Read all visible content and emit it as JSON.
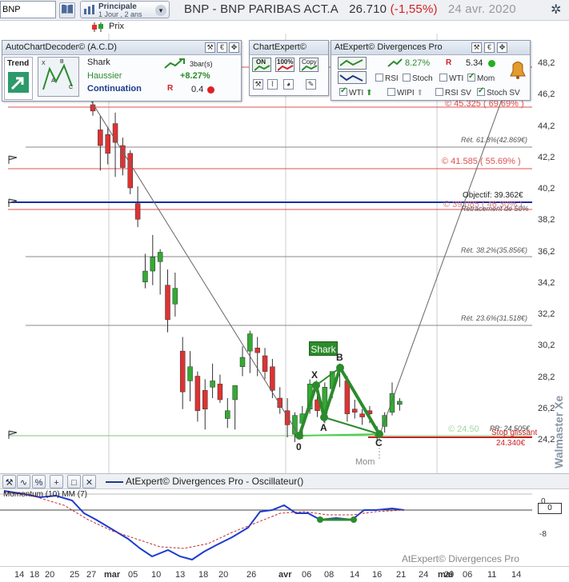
{
  "toolbar": {
    "symbol": "BNP",
    "period_main": "Principale",
    "period_sub": "1 Jour , 2 ans",
    "price_type": "Prix"
  },
  "title": {
    "name": "BNP - BNP PARIBAS ACT.A",
    "price": "26.710",
    "change": "(-1,55%)",
    "date": "24 avr. 2020"
  },
  "acd_panel": {
    "title": "AutoChartDecoder© (A.C.D)",
    "trend_label": "Trend",
    "pattern": "Shark",
    "direction": "Haussier",
    "signal": "Continuation",
    "bars_label": "3bar(s)",
    "gain": "+8.27%",
    "risk": "0.4",
    "mini_letters": [
      "X",
      "B",
      "A",
      "C"
    ]
  },
  "chartexpert_panel": {
    "title": "ChartExpert©",
    "on_label": "ON",
    "pct_label": "100%",
    "copy_label": "Copy"
  },
  "atexpert_panel": {
    "title": "AtExpert© Divergences Pro",
    "gain": "8.27%",
    "value": "5.34",
    "options": [
      {
        "label": "RSI",
        "checked": false
      },
      {
        "label": "Stoch",
        "checked": false
      },
      {
        "label": "WTI",
        "checked": false
      },
      {
        "label": "Mom",
        "checked": true
      }
    ],
    "options2": [
      {
        "label": "WTI",
        "checked": true
      },
      {
        "label": "WIPI",
        "checked": false
      },
      {
        "label": "RSI SV",
        "checked": false
      },
      {
        "label": "Stoch SV",
        "checked": true
      }
    ]
  },
  "chart": {
    "y_ticks": [
      "48,2",
      "46,2",
      "44,2",
      "42,2",
      "40,2",
      "38,2",
      "36,2",
      "34,2",
      "32,2",
      "30,2",
      "28,2",
      "26,2",
      "24,2"
    ],
    "levels": {
      "l1": "© 45.325 ( 69.69% )",
      "l2": "Rét. 61.8%(42.869€)",
      "l3": "© 41.585 ( 55.69% )",
      "l4": "Objectif: 39.362€",
      "l5": "© 39.085 ( 46.30% )",
      "l6": "Retracement de 50%",
      "l7": "Rét. 38.2%(35.856€)",
      "l8": "Rét. 23.6%(31.518€)",
      "l9": "© 24.50",
      "l10": "PR: 24.505€",
      "l11": "Stop glissant",
      "l12": "24.340€"
    },
    "pattern_label": "Shark",
    "points": [
      "X",
      "A",
      "B",
      "C",
      "0"
    ],
    "mom_label": "Mom",
    "watermark": "Walmaster Xe"
  },
  "oscillator": {
    "header": "AtExpert© Divergences Pro - Oscillateur()",
    "sub_label": "Momentum (10) MM (7)",
    "y_ticks": [
      "0",
      "-8"
    ],
    "current_value": "0",
    "footer": "AtExpert© Divergences Pro"
  },
  "xaxis": {
    "labels": [
      "14",
      "18",
      "20",
      "25",
      "27",
      "mar",
      "05",
      "10",
      "13",
      "18",
      "20",
      "26",
      "avr",
      "06",
      "08",
      "14",
      "16",
      "21",
      "24",
      "29",
      "mai",
      "06",
      "11",
      "14"
    ]
  },
  "chart_data": {
    "type": "candlestick",
    "candles": [
      {
        "o": 45.6,
        "h": 46.4,
        "l": 44.9,
        "c": 45.2
      },
      {
        "o": 44.0,
        "h": 44.9,
        "l": 41.4,
        "c": 43.0
      },
      {
        "o": 43.7,
        "h": 44.2,
        "l": 41.8,
        "c": 42.5
      },
      {
        "o": 44.4,
        "h": 45.1,
        "l": 41.0,
        "c": 43.2
      },
      {
        "o": 43.0,
        "h": 43.5,
        "l": 41.1,
        "c": 41.6
      },
      {
        "o": 42.5,
        "h": 42.7,
        "l": 39.9,
        "c": 40.3
      },
      {
        "o": 39.3,
        "h": 40.4,
        "l": 37.8,
        "c": 38.3
      },
      {
        "o": 34.3,
        "h": 36.1,
        "l": 33.9,
        "c": 35.0
      },
      {
        "o": 35.0,
        "h": 37.3,
        "l": 34.1,
        "c": 35.9
      },
      {
        "o": 35.6,
        "h": 36.4,
        "l": 33.5,
        "c": 36.2
      },
      {
        "o": 34.1,
        "h": 35.1,
        "l": 31.1,
        "c": 31.9
      },
      {
        "o": 32.9,
        "h": 34.9,
        "l": 32.1,
        "c": 33.9
      },
      {
        "o": 29.9,
        "h": 30.8,
        "l": 26.2,
        "c": 27.3
      },
      {
        "o": 28.0,
        "h": 29.9,
        "l": 26.7,
        "c": 28.9
      },
      {
        "o": 28.3,
        "h": 28.6,
        "l": 25.4,
        "c": 26.1
      },
      {
        "o": 27.4,
        "h": 28.1,
        "l": 24.9,
        "c": 26.2
      },
      {
        "o": 27.6,
        "h": 29.1,
        "l": 26.9,
        "c": 28.0
      },
      {
        "o": 27.8,
        "h": 28.4,
        "l": 26.6,
        "c": 26.8
      },
      {
        "o": 25.6,
        "h": 26.9,
        "l": 25.0,
        "c": 26.1
      },
      {
        "o": 26.8,
        "h": 27.6,
        "l": 24.9,
        "c": 27.7
      },
      {
        "o": 28.9,
        "h": 30.2,
        "l": 28.3,
        "c": 29.5
      },
      {
        "o": 29.9,
        "h": 31.2,
        "l": 28.5,
        "c": 31.0
      },
      {
        "o": 30.1,
        "h": 30.8,
        "l": 28.3,
        "c": 29.8
      },
      {
        "o": 29.6,
        "h": 30.1,
        "l": 28.1,
        "c": 28.6
      },
      {
        "o": 28.9,
        "h": 29.4,
        "l": 26.9,
        "c": 27.4
      },
      {
        "o": 26.9,
        "h": 27.6,
        "l": 25.9,
        "c": 26.3
      },
      {
        "o": 26.1,
        "h": 26.9,
        "l": 24.4,
        "c": 25.2
      },
      {
        "o": 24.6,
        "h": 26.0,
        "l": 24.1,
        "c": 25.8
      },
      {
        "o": 25.3,
        "h": 26.4,
        "l": 24.3,
        "c": 25.9
      },
      {
        "o": 26.2,
        "h": 28.1,
        "l": 25.9,
        "c": 27.8
      },
      {
        "o": 26.8,
        "h": 27.4,
        "l": 25.7,
        "c": 26.1
      },
      {
        "o": 25.9,
        "h": 27.9,
        "l": 25.3,
        "c": 27.6
      },
      {
        "o": 27.5,
        "h": 28.2,
        "l": 26.9,
        "c": 28.6
      },
      {
        "o": 28.6,
        "h": 29.1,
        "l": 27.6,
        "c": 28.9
      },
      {
        "o": 28.0,
        "h": 28.3,
        "l": 25.4,
        "c": 25.9
      },
      {
        "o": 26.2,
        "h": 26.8,
        "l": 25.6,
        "c": 26.0
      },
      {
        "o": 25.9,
        "h": 26.2,
        "l": 25.2,
        "c": 25.7
      },
      {
        "o": 26.1,
        "h": 26.4,
        "l": 25.3,
        "c": 25.9
      },
      {
        "o": 24.6,
        "h": 25.1,
        "l": 24.2,
        "c": 24.6
      },
      {
        "o": 25.1,
        "h": 26.0,
        "l": 24.7,
        "c": 25.8
      },
      {
        "o": 26.0,
        "h": 27.9,
        "l": 25.8,
        "c": 27.2
      },
      {
        "o": 26.5,
        "h": 26.9,
        "l": 26.1,
        "c": 26.7
      }
    ],
    "ylim": [
      23.4,
      49.4
    ]
  }
}
